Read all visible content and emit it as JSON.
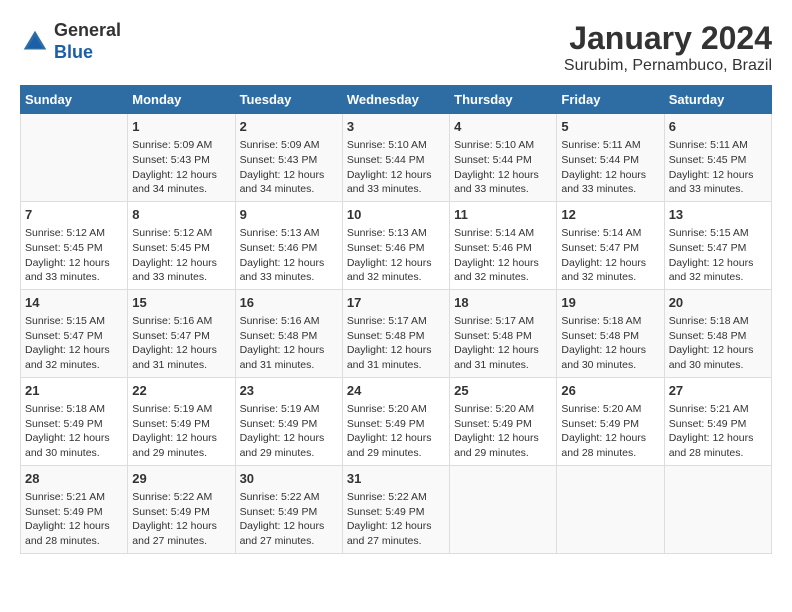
{
  "header": {
    "logo_line1": "General",
    "logo_line2": "Blue",
    "main_title": "January 2024",
    "subtitle": "Surubim, Pernambuco, Brazil"
  },
  "days_of_week": [
    "Sunday",
    "Monday",
    "Tuesday",
    "Wednesday",
    "Thursday",
    "Friday",
    "Saturday"
  ],
  "weeks": [
    [
      {
        "day": "",
        "info": ""
      },
      {
        "day": "1",
        "info": "Sunrise: 5:09 AM\nSunset: 5:43 PM\nDaylight: 12 hours\nand 34 minutes."
      },
      {
        "day": "2",
        "info": "Sunrise: 5:09 AM\nSunset: 5:43 PM\nDaylight: 12 hours\nand 34 minutes."
      },
      {
        "day": "3",
        "info": "Sunrise: 5:10 AM\nSunset: 5:44 PM\nDaylight: 12 hours\nand 33 minutes."
      },
      {
        "day": "4",
        "info": "Sunrise: 5:10 AM\nSunset: 5:44 PM\nDaylight: 12 hours\nand 33 minutes."
      },
      {
        "day": "5",
        "info": "Sunrise: 5:11 AM\nSunset: 5:44 PM\nDaylight: 12 hours\nand 33 minutes."
      },
      {
        "day": "6",
        "info": "Sunrise: 5:11 AM\nSunset: 5:45 PM\nDaylight: 12 hours\nand 33 minutes."
      }
    ],
    [
      {
        "day": "7",
        "info": "Sunrise: 5:12 AM\nSunset: 5:45 PM\nDaylight: 12 hours\nand 33 minutes."
      },
      {
        "day": "8",
        "info": "Sunrise: 5:12 AM\nSunset: 5:45 PM\nDaylight: 12 hours\nand 33 minutes."
      },
      {
        "day": "9",
        "info": "Sunrise: 5:13 AM\nSunset: 5:46 PM\nDaylight: 12 hours\nand 33 minutes."
      },
      {
        "day": "10",
        "info": "Sunrise: 5:13 AM\nSunset: 5:46 PM\nDaylight: 12 hours\nand 32 minutes."
      },
      {
        "day": "11",
        "info": "Sunrise: 5:14 AM\nSunset: 5:46 PM\nDaylight: 12 hours\nand 32 minutes."
      },
      {
        "day": "12",
        "info": "Sunrise: 5:14 AM\nSunset: 5:47 PM\nDaylight: 12 hours\nand 32 minutes."
      },
      {
        "day": "13",
        "info": "Sunrise: 5:15 AM\nSunset: 5:47 PM\nDaylight: 12 hours\nand 32 minutes."
      }
    ],
    [
      {
        "day": "14",
        "info": "Sunrise: 5:15 AM\nSunset: 5:47 PM\nDaylight: 12 hours\nand 32 minutes."
      },
      {
        "day": "15",
        "info": "Sunrise: 5:16 AM\nSunset: 5:47 PM\nDaylight: 12 hours\nand 31 minutes."
      },
      {
        "day": "16",
        "info": "Sunrise: 5:16 AM\nSunset: 5:48 PM\nDaylight: 12 hours\nand 31 minutes."
      },
      {
        "day": "17",
        "info": "Sunrise: 5:17 AM\nSunset: 5:48 PM\nDaylight: 12 hours\nand 31 minutes."
      },
      {
        "day": "18",
        "info": "Sunrise: 5:17 AM\nSunset: 5:48 PM\nDaylight: 12 hours\nand 31 minutes."
      },
      {
        "day": "19",
        "info": "Sunrise: 5:18 AM\nSunset: 5:48 PM\nDaylight: 12 hours\nand 30 minutes."
      },
      {
        "day": "20",
        "info": "Sunrise: 5:18 AM\nSunset: 5:48 PM\nDaylight: 12 hours\nand 30 minutes."
      }
    ],
    [
      {
        "day": "21",
        "info": "Sunrise: 5:18 AM\nSunset: 5:49 PM\nDaylight: 12 hours\nand 30 minutes."
      },
      {
        "day": "22",
        "info": "Sunrise: 5:19 AM\nSunset: 5:49 PM\nDaylight: 12 hours\nand 29 minutes."
      },
      {
        "day": "23",
        "info": "Sunrise: 5:19 AM\nSunset: 5:49 PM\nDaylight: 12 hours\nand 29 minutes."
      },
      {
        "day": "24",
        "info": "Sunrise: 5:20 AM\nSunset: 5:49 PM\nDaylight: 12 hours\nand 29 minutes."
      },
      {
        "day": "25",
        "info": "Sunrise: 5:20 AM\nSunset: 5:49 PM\nDaylight: 12 hours\nand 29 minutes."
      },
      {
        "day": "26",
        "info": "Sunrise: 5:20 AM\nSunset: 5:49 PM\nDaylight: 12 hours\nand 28 minutes."
      },
      {
        "day": "27",
        "info": "Sunrise: 5:21 AM\nSunset: 5:49 PM\nDaylight: 12 hours\nand 28 minutes."
      }
    ],
    [
      {
        "day": "28",
        "info": "Sunrise: 5:21 AM\nSunset: 5:49 PM\nDaylight: 12 hours\nand 28 minutes."
      },
      {
        "day": "29",
        "info": "Sunrise: 5:22 AM\nSunset: 5:49 PM\nDaylight: 12 hours\nand 27 minutes."
      },
      {
        "day": "30",
        "info": "Sunrise: 5:22 AM\nSunset: 5:49 PM\nDaylight: 12 hours\nand 27 minutes."
      },
      {
        "day": "31",
        "info": "Sunrise: 5:22 AM\nSunset: 5:49 PM\nDaylight: 12 hours\nand 27 minutes."
      },
      {
        "day": "",
        "info": ""
      },
      {
        "day": "",
        "info": ""
      },
      {
        "day": "",
        "info": ""
      }
    ]
  ]
}
